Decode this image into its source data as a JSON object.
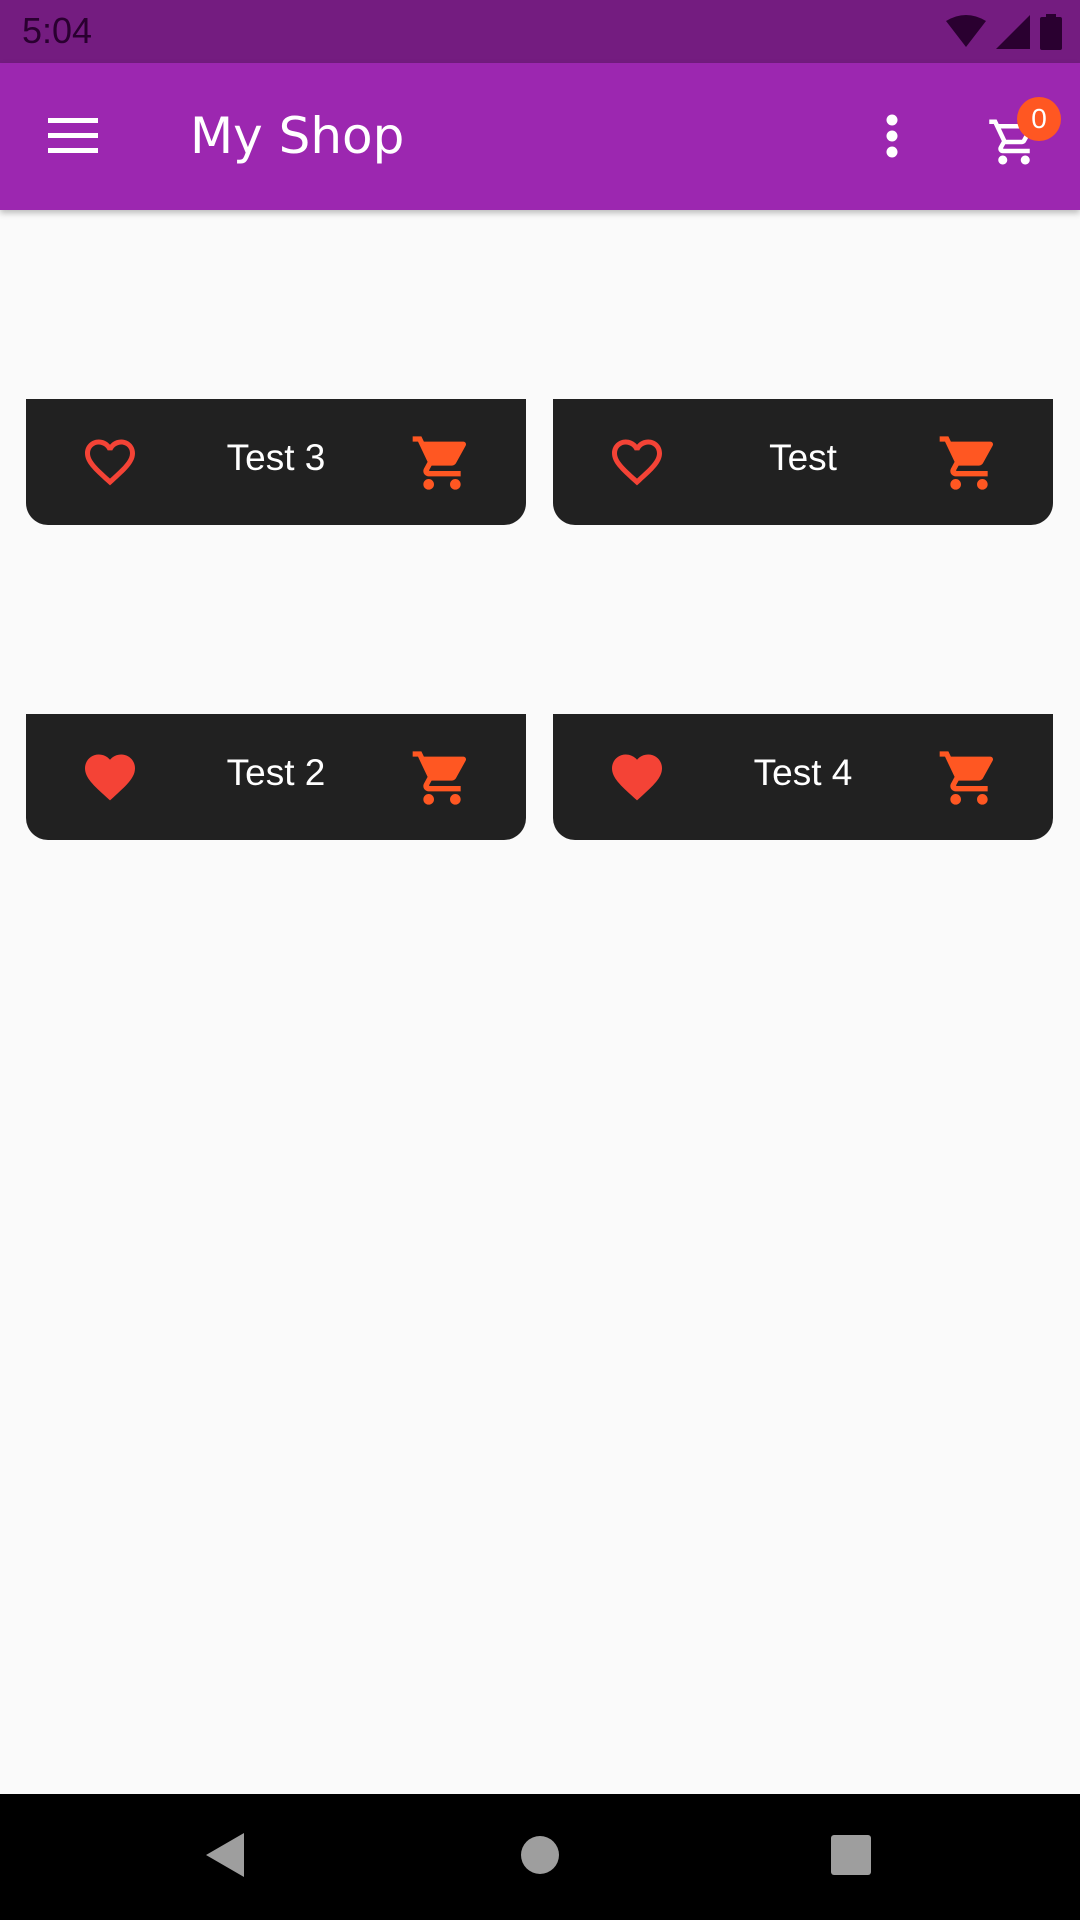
{
  "status_bar": {
    "time": "5:04"
  },
  "app_bar": {
    "title": "My Shop",
    "cart_count": "0"
  },
  "products": [
    {
      "title": "Test 3",
      "favorite": false
    },
    {
      "title": "Test",
      "favorite": false
    },
    {
      "title": "Test 2",
      "favorite": true
    },
    {
      "title": "Test 4",
      "favorite": true
    }
  ],
  "colors": {
    "app_bar": "#9c27b0",
    "status_bar": "#741c80",
    "card": "#212121",
    "accent": "#ff5722",
    "favorite": "#f44336"
  },
  "icons": {
    "menu": "menu-icon",
    "more": "more-vert-icon",
    "cart": "shopping-cart-icon",
    "favorite_outline": "favorite-border-icon",
    "favorite_filled": "favorite-icon",
    "back": "back-icon",
    "home": "home-icon",
    "recents": "recents-icon"
  }
}
